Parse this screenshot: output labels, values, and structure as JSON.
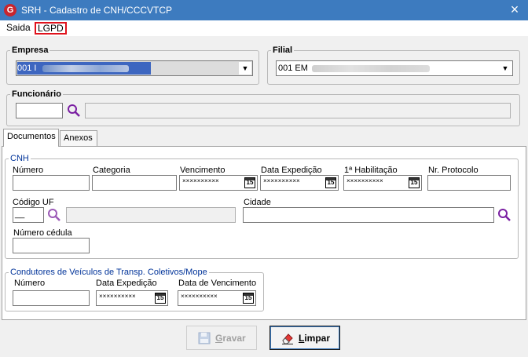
{
  "window": {
    "title": "SRH - Cadastro de CNH/CCCVTCP",
    "app_icon": "app-logo-icon",
    "close": "×"
  },
  "menu": {
    "saida": "Saida",
    "lgpd": "LGPD",
    "highlight_color": "#e0121c"
  },
  "empresa": {
    "legend": "Empresa",
    "value": "001 I"
  },
  "filial": {
    "legend": "Filial",
    "value": "001 EM"
  },
  "funcionario": {
    "legend": "Funcionário",
    "code": "",
    "name": ""
  },
  "tabs": [
    {
      "label": "Documentos",
      "active": true
    },
    {
      "label": "Anexos",
      "active": false
    }
  ],
  "cnh": {
    "legend": "CNH",
    "numero_label": "Número",
    "categoria_label": "Categoria",
    "vencimento_label": "Vencimento",
    "data_expedicao_label": "Data Expedição",
    "primeira_habilitacao_label": "1ª Habilitação",
    "nr_protocolo_label": "Nr. Protocolo",
    "codigo_uf_label": "Código UF",
    "codigo_uf_value": "__",
    "cidade_label": "Cidade",
    "numero_cedula_label": "Número cédula",
    "date_mask": "××××××××××",
    "calendar_glyph": "15"
  },
  "condutores": {
    "legend": "Condutores de Veículos de Transp. Coletivos/Mope",
    "numero_label": "Número",
    "data_expedicao_label": "Data Expedição",
    "data_vencimento_label": "Data de Vencimento"
  },
  "buttons": {
    "gravar_pre": "",
    "gravar_u": "G",
    "gravar_post": "ravar",
    "limpar_pre": "",
    "limpar_u": "L",
    "limpar_post": "impar"
  },
  "colors": {
    "titlebar": "#3d7bbf",
    "legend_blue": "#003399",
    "search_icon": "#7a1fa2"
  }
}
